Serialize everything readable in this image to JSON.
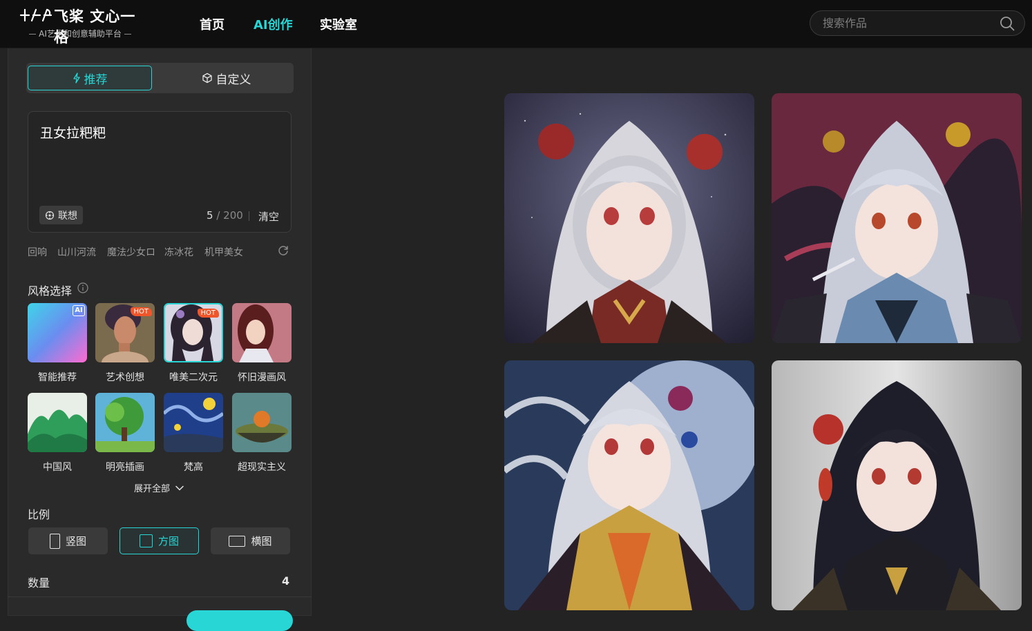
{
  "header": {
    "logo_title": "飞桨 文心一格",
    "logo_subtitle": "AI艺术和创意辅助平台",
    "nav": [
      {
        "label": "首页",
        "active": false
      },
      {
        "label": "AI创作",
        "active": true
      },
      {
        "label": "实验室",
        "active": false
      }
    ],
    "search_placeholder": "搜索作品"
  },
  "mode_tabs": [
    {
      "label": "推荐",
      "icon": "bolt-icon",
      "active": true
    },
    {
      "label": "自定义",
      "icon": "cube-icon",
      "active": false
    }
  ],
  "prompt": {
    "text": "丑女拉粑粑",
    "assoc_label": "联想",
    "count": "5",
    "max": "/ 200",
    "clear_label": "清空"
  },
  "suggestions": [
    "回响",
    "山川河流",
    "魔法少女ロ",
    "冻冰花",
    "机甲美女"
  ],
  "style_section": {
    "title": "风格选择",
    "styles": [
      {
        "label": "智能推荐",
        "badge": "AI",
        "selected": false
      },
      {
        "label": "艺术创想",
        "badge": "HOT",
        "selected": false
      },
      {
        "label": "唯美二次元",
        "badge": "HOT",
        "selected": true
      },
      {
        "label": "怀旧漫画风",
        "badge": "",
        "selected": false
      },
      {
        "label": "中国风",
        "badge": "",
        "selected": false
      },
      {
        "label": "明亮插画",
        "badge": "",
        "selected": false
      },
      {
        "label": "梵高",
        "badge": "",
        "selected": false
      },
      {
        "label": "超现实主义",
        "badge": "",
        "selected": false
      }
    ],
    "expand_label": "展开全部"
  },
  "ratio_section": {
    "title": "比例",
    "options": [
      {
        "label": "竖图",
        "active": false
      },
      {
        "label": "方图",
        "active": true
      },
      {
        "label": "横图",
        "active": false
      }
    ]
  },
  "quantity_section": {
    "title": "数量",
    "value": "4"
  },
  "colors": {
    "accent": "#29d6d6",
    "header_bg": "#0f0f0f",
    "page_bg": "#232323",
    "hot_badge": "#f0562a"
  },
  "gallery": [
    {
      "subject": "silver-haired girl with red flower ornaments, starry night"
    },
    {
      "subject": "silver-haired girl holding brush, red ink swirls"
    },
    {
      "subject": "silver-haired girl with blue hair ornament, moon background"
    },
    {
      "subject": "black-haired girl with red hairpin, grey background"
    }
  ]
}
